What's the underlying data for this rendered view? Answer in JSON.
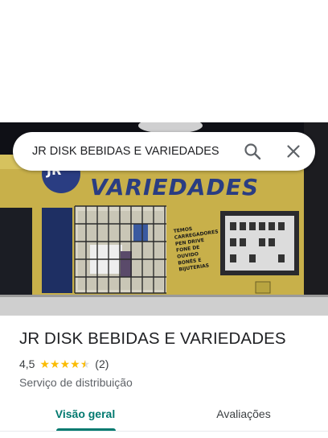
{
  "search": {
    "query": "JR DISK BEBIDAS E VARIEDADES",
    "search_icon": "search-icon",
    "close_icon": "close-icon"
  },
  "photo": {
    "wall_sign": "VARIEDADES",
    "wall_logo": "JR",
    "wall_list": [
      "TEMOS",
      "CARREGADORES",
      "PEN DRIVE",
      "FONE DE OUVIDO",
      "BONÉS E",
      "BIJUTERIAS"
    ]
  },
  "place": {
    "name": "JR DISK BEBIDAS E VARIEDADES",
    "rating": "4,5",
    "rating_value": 4.5,
    "review_count": "(2)",
    "category": "Serviço de distribuição"
  },
  "tabs": {
    "overview": "Visão geral",
    "reviews": "Avaliações"
  },
  "colors": {
    "accent": "#01796f",
    "star": "#fbbc04",
    "wall": "#c9b34a",
    "sign_text": "#2a3d82"
  }
}
